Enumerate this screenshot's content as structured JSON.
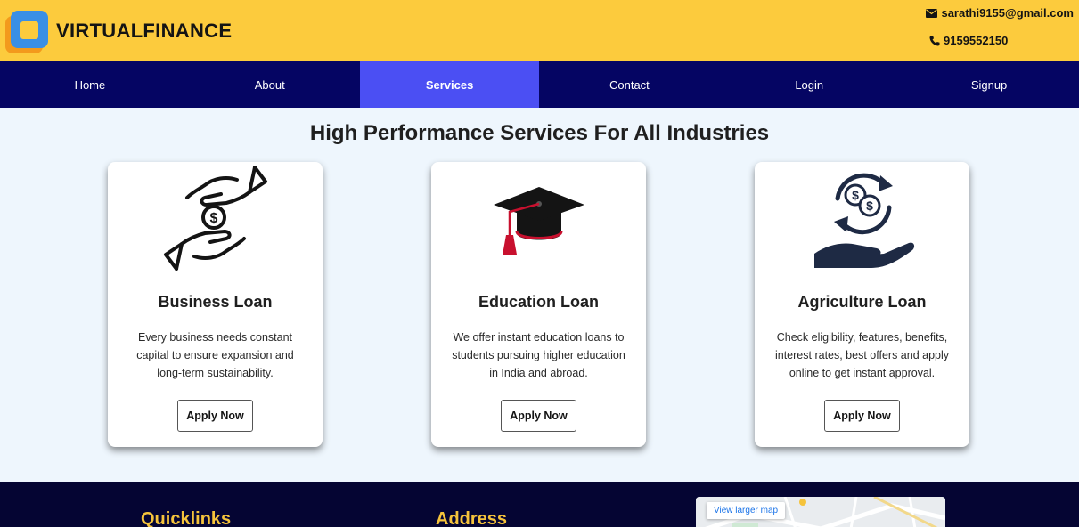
{
  "header": {
    "brand": "VIRTUALFINANCE",
    "email": "sarathi9155@gmail.com",
    "phone": "9159552150"
  },
  "nav": {
    "items": [
      "Home",
      "About",
      "Services",
      "Contact",
      "Login",
      "Signup"
    ],
    "active": "Services"
  },
  "main": {
    "title": "High Performance Services For All Industries",
    "cards": [
      {
        "icon": "money-hands-icon",
        "title": "Business Loan",
        "description": "Every business needs constant capital to ensure expansion and long-term sustainability.",
        "button": "Apply Now"
      },
      {
        "icon": "graduation-cap-icon",
        "title": "Education Loan",
        "description": "We offer instant education loans to students pursuing higher education in India and abroad.",
        "button": "Apply Now"
      },
      {
        "icon": "money-exchange-hand-icon",
        "title": "Agriculture Loan",
        "description": "Check eligibility, features, benefits, interest rates, best offers and apply online to get instant approval.",
        "button": "Apply Now"
      }
    ]
  },
  "footer": {
    "quicklinks_heading": "Quicklinks",
    "address_heading": "Address",
    "map_link": "View larger map"
  },
  "colors": {
    "header_bg": "#fccb3d",
    "nav_bg": "#050563",
    "nav_active": "#4b4ff3",
    "footer_bg": "#050533",
    "footer_heading": "#f5c33b"
  }
}
